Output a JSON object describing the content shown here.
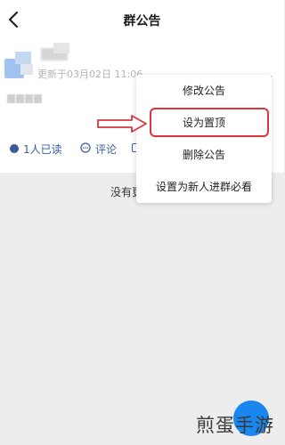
{
  "header": {
    "title": "群公告",
    "back_icon": "chevron-left-icon"
  },
  "post": {
    "meta_time": "更新于03月02日 11:06",
    "more_icon": "more-horizontal-icon",
    "read_count_label": "1人已读",
    "comment_label": "评论"
  },
  "menu": {
    "items": [
      {
        "label": "修改公告"
      },
      {
        "label": "设为置顶"
      },
      {
        "label": "删除公告"
      },
      {
        "label": "设置为新人进群必看"
      }
    ],
    "highlight_color": "#d9363e"
  },
  "empty_state": {
    "text": "没有更"
  },
  "watermark": {
    "text": "煎蛋手游"
  },
  "colors": {
    "accent": "#1a86f0",
    "link": "#3b5ea8",
    "background": "#ededed"
  }
}
